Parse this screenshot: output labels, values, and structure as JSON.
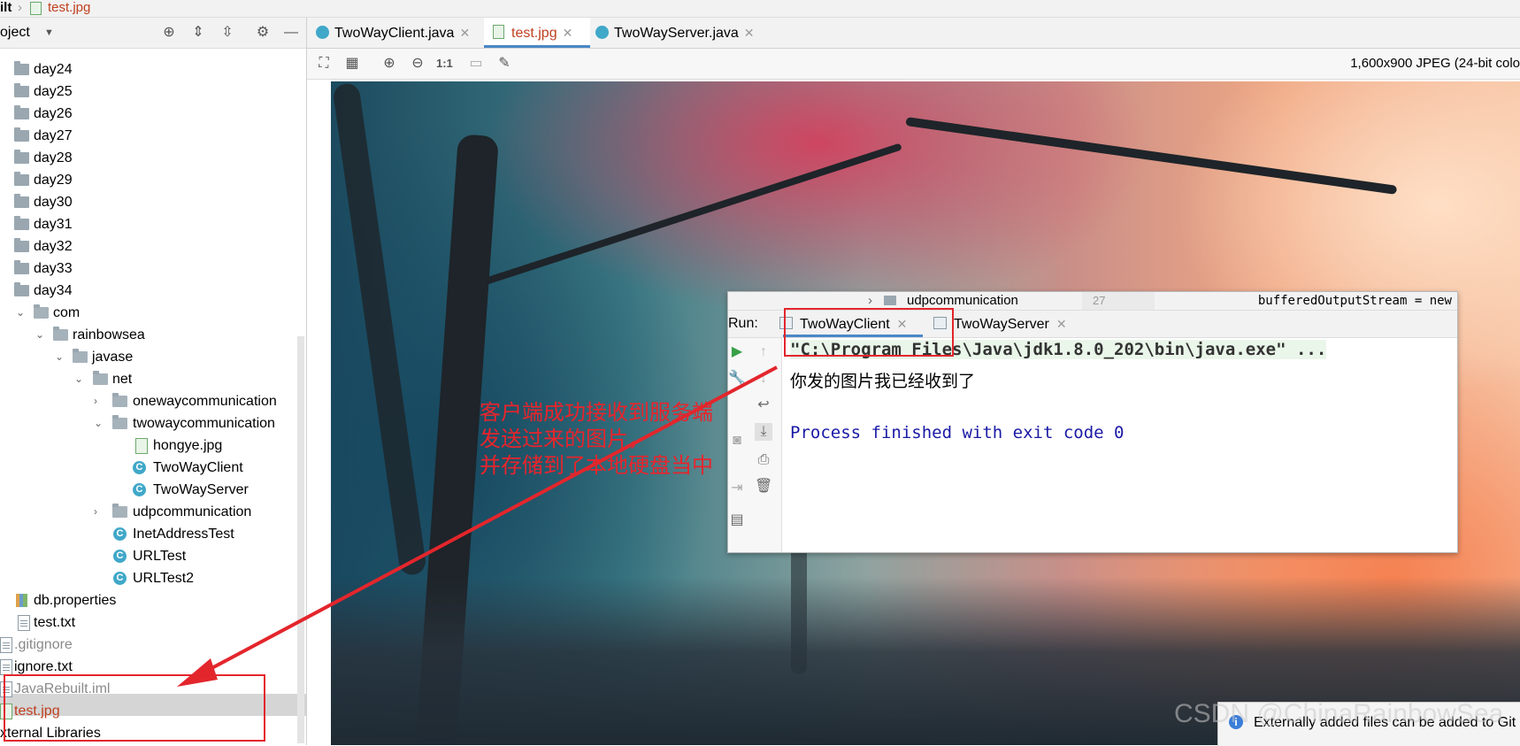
{
  "breadcrumb": {
    "project": "ilt",
    "file": "test.jpg"
  },
  "project_panel": {
    "title": "oject",
    "tree": [
      {
        "label": "day24",
        "kind": "folder"
      },
      {
        "label": "day25",
        "kind": "folder"
      },
      {
        "label": "day26",
        "kind": "folder"
      },
      {
        "label": "day27",
        "kind": "folder"
      },
      {
        "label": "day28",
        "kind": "folder"
      },
      {
        "label": "day29",
        "kind": "folder"
      },
      {
        "label": "day30",
        "kind": "folder"
      },
      {
        "label": "day31",
        "kind": "folder"
      },
      {
        "label": "day32",
        "kind": "folder"
      },
      {
        "label": "day33",
        "kind": "folder"
      },
      {
        "label": "day34",
        "kind": "folder"
      },
      {
        "label": "com",
        "kind": "package"
      },
      {
        "label": "rainbowsea",
        "kind": "package"
      },
      {
        "label": "javase",
        "kind": "package"
      },
      {
        "label": "net",
        "kind": "package"
      },
      {
        "label": "onewaycommunication",
        "kind": "package"
      },
      {
        "label": "twowaycommunication",
        "kind": "package"
      },
      {
        "label": "hongye.jpg",
        "kind": "image"
      },
      {
        "label": "TwoWayClient",
        "kind": "class"
      },
      {
        "label": "TwoWayServer",
        "kind": "class"
      },
      {
        "label": "udpcommunication",
        "kind": "package"
      },
      {
        "label": "InetAddressTest",
        "kind": "class"
      },
      {
        "label": "URLTest",
        "kind": "class"
      },
      {
        "label": "URLTest2",
        "kind": "class"
      },
      {
        "label": "db.properties",
        "kind": "properties"
      },
      {
        "label": "test.txt",
        "kind": "file"
      },
      {
        "label": ".gitignore",
        "kind": "file"
      },
      {
        "label": "ignore.txt",
        "kind": "file"
      },
      {
        "label": "JavaRebuilt.iml",
        "kind": "file"
      },
      {
        "label": "test.jpg",
        "kind": "image"
      },
      {
        "label": "xternal Libraries",
        "kind": "library"
      }
    ]
  },
  "editor_tabs": [
    {
      "label": "TwoWayClient.java",
      "active": false
    },
    {
      "label": "test.jpg",
      "active": true
    },
    {
      "label": "TwoWayServer.java",
      "active": false
    }
  ],
  "image_toolbar": {
    "info": "1,600x900 JPEG (24-bit colo",
    "actual_size_label": "1:1"
  },
  "run_window": {
    "top_strip_folder": "udpcommunication",
    "top_strip_line": "27",
    "top_strip_code": "bufferedOutputStream = new",
    "run_label": "Run:",
    "tabs": [
      {
        "label": "TwoWayClient",
        "active": true
      },
      {
        "label": "TwoWayServer",
        "active": false
      }
    ],
    "console": {
      "command": "\"C:\\Program Files\\Java\\jdk1.8.0_202\\bin\\java.exe\" ...",
      "output": "你发的图片我已经收到了",
      "finished": "Process finished with exit code 0"
    }
  },
  "annotation": {
    "lines": [
      "客户端成功接收到服务端",
      "发送过来的图片，",
      "并存储到了本地硬盘当中"
    ],
    "color": "#e8242c"
  },
  "notification": {
    "text": "Externally added files can be added to Git"
  },
  "watermark": "CSDN @ChinaRainbowSea"
}
